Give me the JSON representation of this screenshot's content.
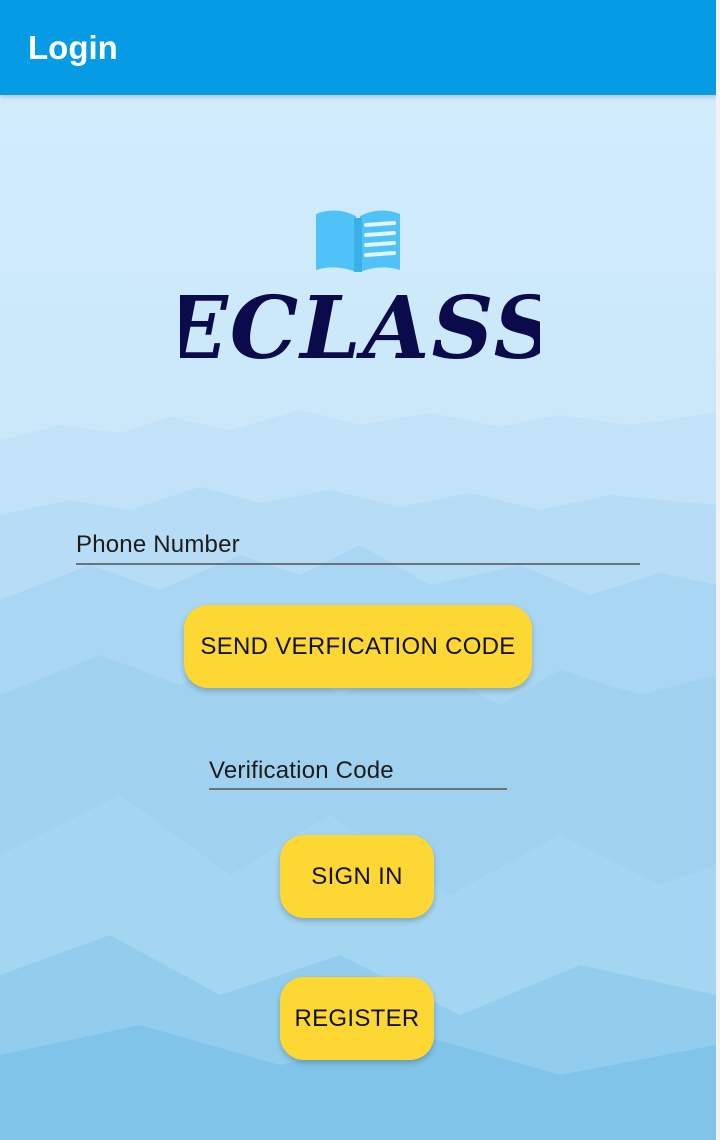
{
  "appbar": {
    "title": "Login"
  },
  "logo": {
    "icon": "open-book-icon",
    "text": "ECLASS"
  },
  "form": {
    "phone_placeholder": "Phone Number",
    "send_code_label": "SEND VERFICATION CODE",
    "code_placeholder": "Verification Code",
    "sign_in_label": "SIGN IN",
    "register_label": "REGISTER"
  },
  "colors": {
    "appbar": "#059be5",
    "button": "#fdd835",
    "logo_text": "#0b0a4a",
    "logo_icon": "#4fc3f7"
  }
}
